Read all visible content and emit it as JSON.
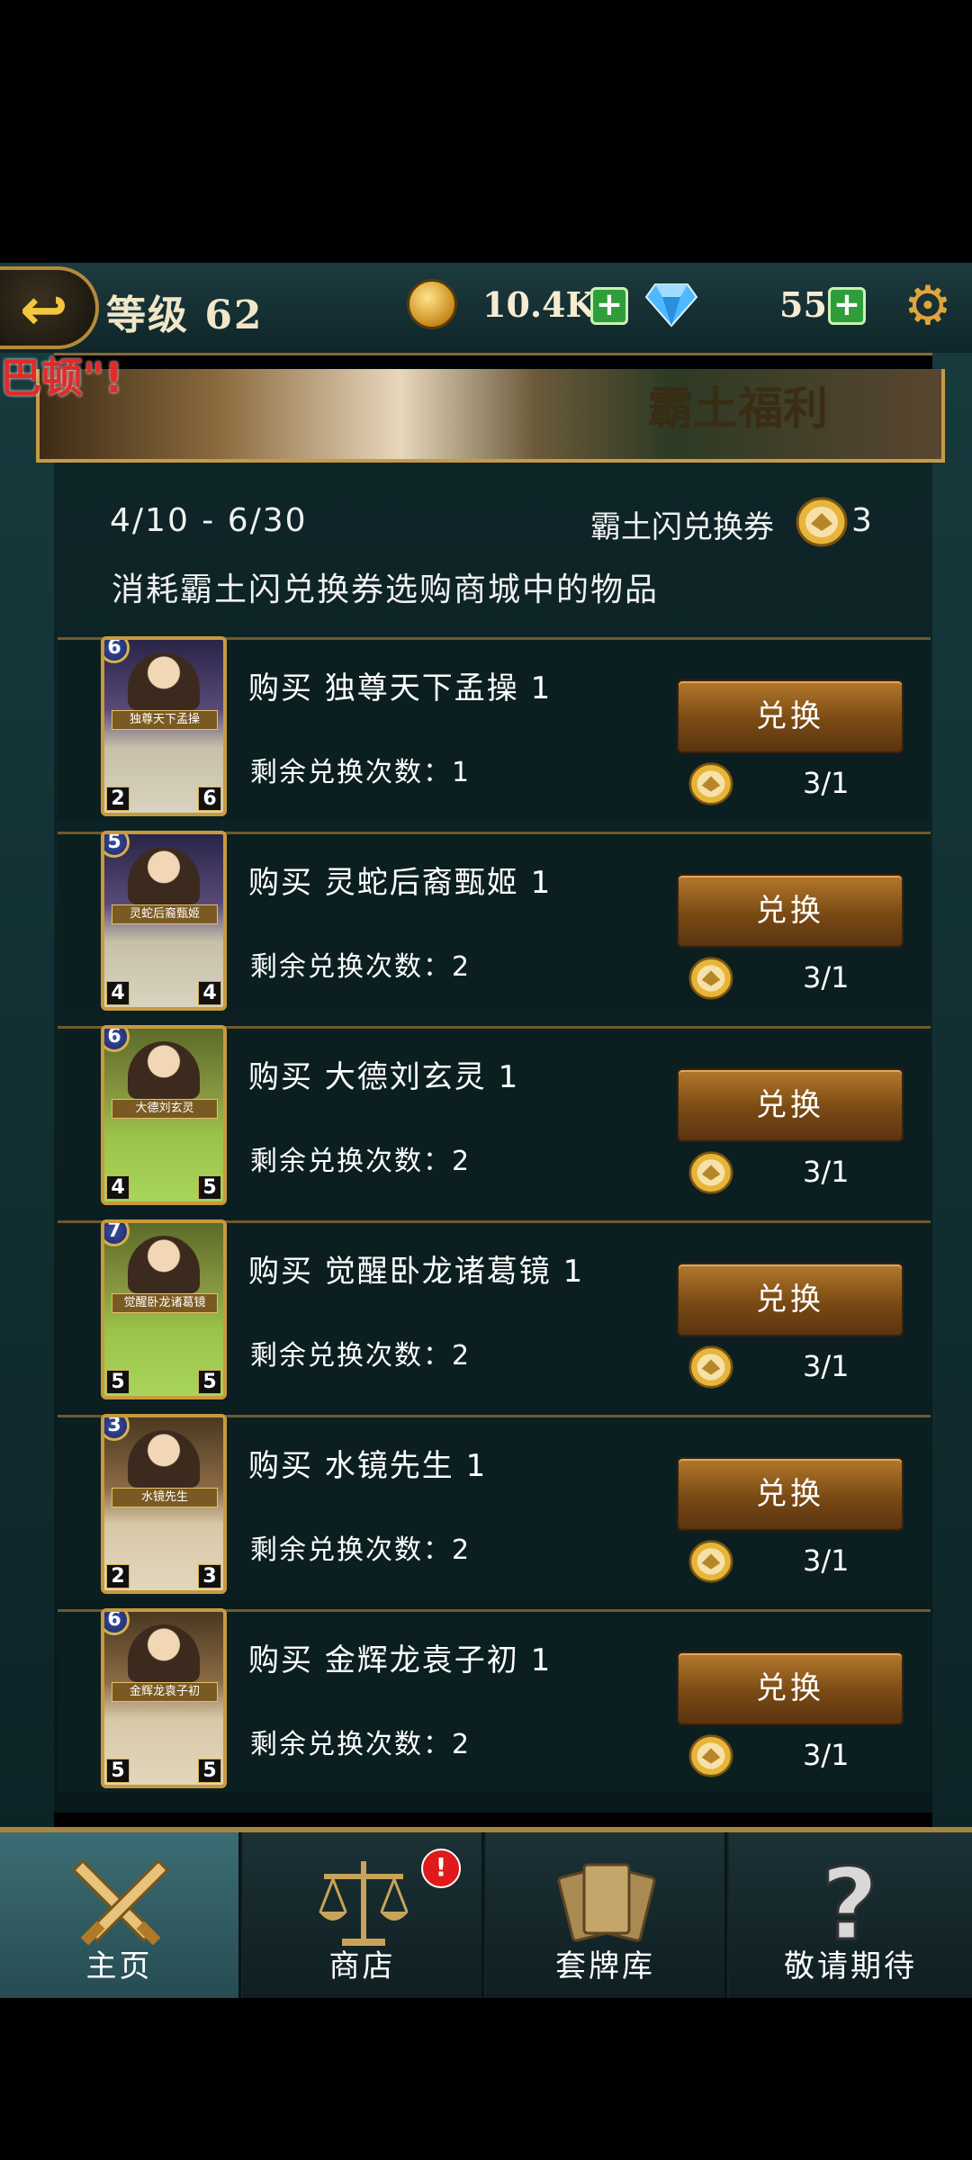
{
  "header": {
    "level_label": "等级 62",
    "gold_value": "10.4K",
    "gem_value": "55",
    "plus_symbol": "+"
  },
  "promo_overlay_text": "巴顿\"!",
  "banner": {
    "title": "霸土福利"
  },
  "event": {
    "date_range": "4/10 - 6/30",
    "voucher_label": "霸土闪兑换券",
    "voucher_count": "3",
    "description": "消耗霸土闪兑换券选购商城中的物品"
  },
  "items": [
    {
      "title": "购买 独尊天下孟操 1",
      "remain": "剩余兑换次数：1",
      "button": "兑换",
      "cost": "3/1",
      "card": {
        "cost": "6",
        "atk": "2",
        "hp": "6",
        "name": "独尊天下孟操"
      }
    },
    {
      "title": "购买 灵蛇后裔甄姬 1",
      "remain": "剩余兑换次数：2",
      "button": "兑换",
      "cost": "3/1",
      "card": {
        "cost": "5",
        "atk": "4",
        "hp": "4",
        "name": "灵蛇后裔甄姬"
      }
    },
    {
      "title": "购买 大德刘玄灵 1",
      "remain": "剩余兑换次数：2",
      "button": "兑换",
      "cost": "3/1",
      "card": {
        "cost": "6",
        "atk": "4",
        "hp": "5",
        "name": "大德刘玄灵"
      }
    },
    {
      "title": "购买 觉醒卧龙诸葛镜 1",
      "remain": "剩余兑换次数：2",
      "button": "兑换",
      "cost": "3/1",
      "card": {
        "cost": "7",
        "atk": "5",
        "hp": "5",
        "name": "觉醒卧龙诸葛镜"
      }
    },
    {
      "title": "购买 水镜先生 1",
      "remain": "剩余兑换次数：2",
      "button": "兑换",
      "cost": "3/1",
      "card": {
        "cost": "3",
        "atk": "2",
        "hp": "3",
        "name": "水镜先生"
      }
    },
    {
      "title": "购买 金辉龙袁子初 1",
      "remain": "剩余兑换次数：2",
      "button": "兑换",
      "cost": "3/1",
      "card": {
        "cost": "6",
        "atk": "5",
        "hp": "5",
        "name": "金辉龙袁子初"
      }
    }
  ],
  "nav": {
    "home": "主页",
    "shop": "商店",
    "deck": "套牌库",
    "coming_soon": "敬请期待",
    "shop_badge": "!"
  },
  "colors": {
    "accent_gold": "#c89a44",
    "button_brown": "#7a4a14",
    "plus_green": "#2f9e3a",
    "alert_red": "#e01a1a"
  }
}
